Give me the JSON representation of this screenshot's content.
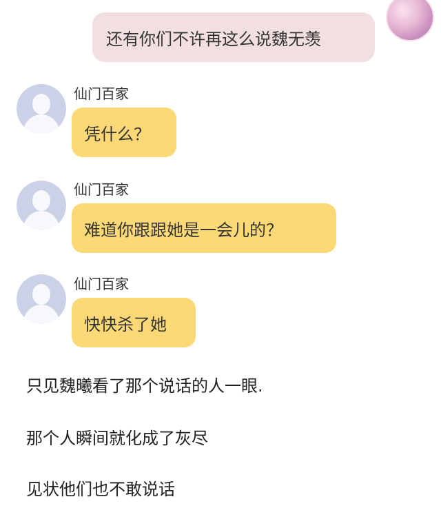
{
  "outgoing_message": {
    "text": "还有你们不许再这么说魏无羡"
  },
  "messages": [
    {
      "sender": "仙门百家",
      "text": "凭什么？"
    },
    {
      "sender": "仙门百家",
      "text": "难道你跟跟她是一会儿的？"
    },
    {
      "sender": "仙门百家",
      "text": "快快杀了她"
    }
  ],
  "narration": [
    "只见魏曦看了那个说话的人一眼.",
    "那个人瞬间就化成了灰尽",
    "见状他们也不敢说话"
  ],
  "colors": {
    "outgoing_bubble": "#f2dfe0",
    "incoming_bubble": "#fcd976",
    "default_avatar": "#cbd1e6"
  }
}
